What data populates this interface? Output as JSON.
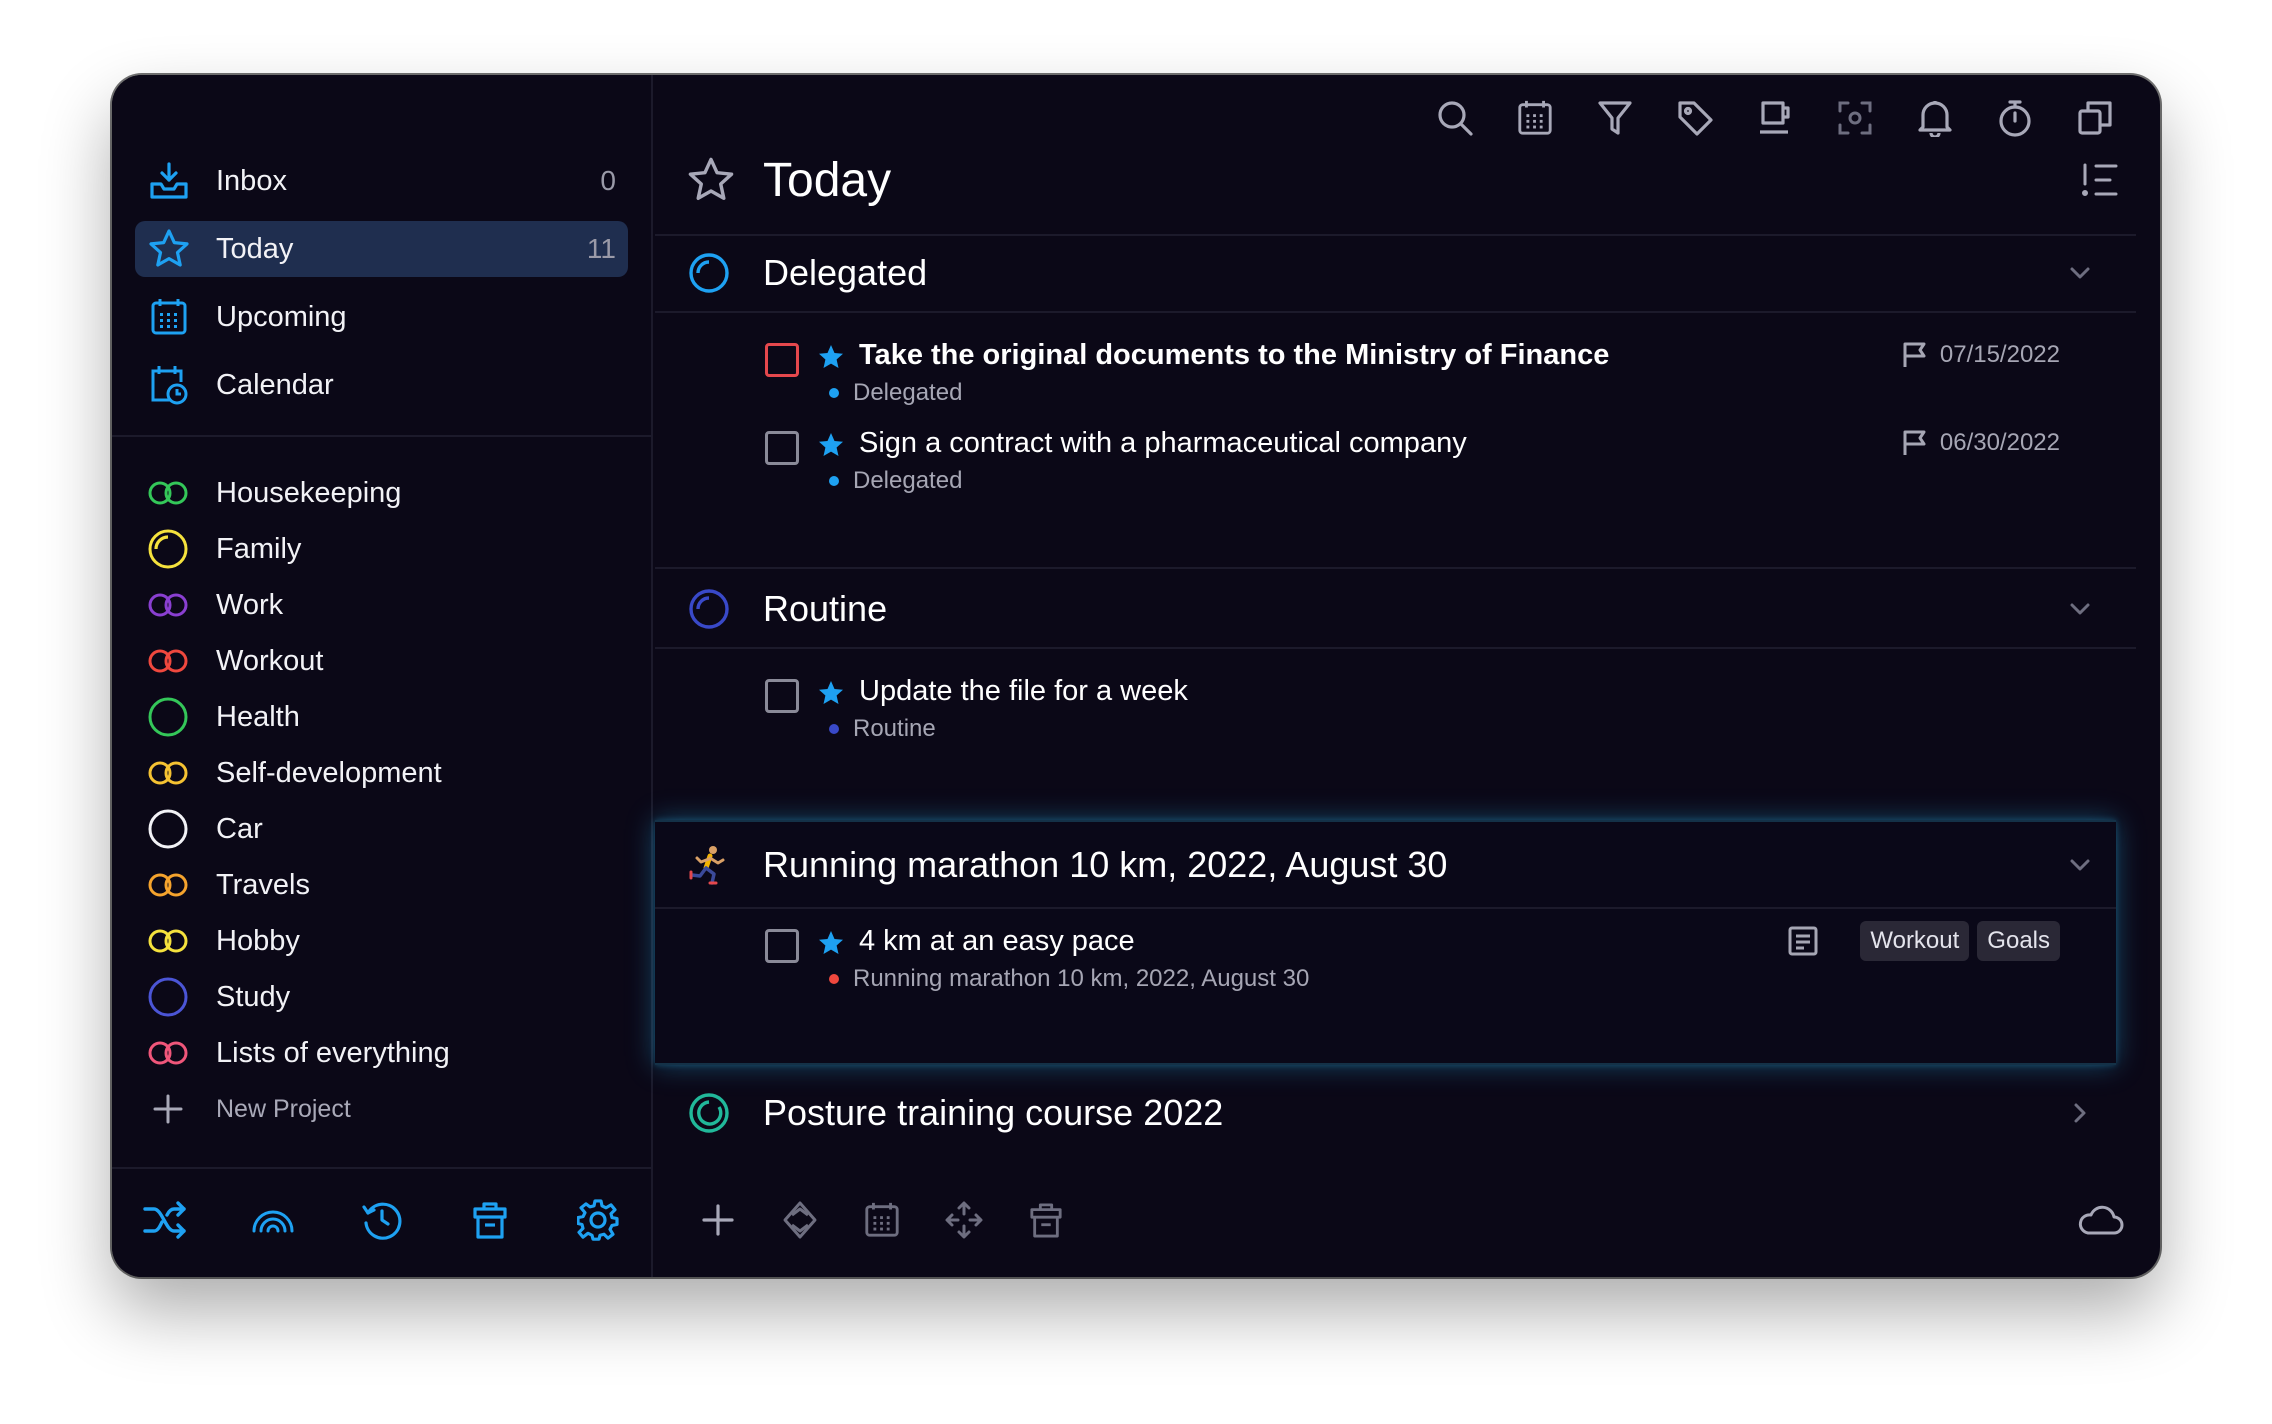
{
  "sidebar": {
    "nav": [
      {
        "label": "Inbox",
        "count": "0",
        "icon": "inbox-tray-icon"
      },
      {
        "label": "Today",
        "count": "11",
        "icon": "star-icon"
      },
      {
        "label": "Upcoming",
        "count": "",
        "icon": "calendar-grid-icon"
      },
      {
        "label": "Calendar",
        "count": "",
        "icon": "calendar-clock-icon"
      }
    ],
    "projects": [
      {
        "label": "Housekeeping",
        "color": "#34c759",
        "icon": "infinity-icon"
      },
      {
        "label": "Family",
        "color": "#f5e23d",
        "icon": "progress-circle-icon"
      },
      {
        "label": "Work",
        "color": "#8a3fd1",
        "icon": "infinity-icon"
      },
      {
        "label": "Workout",
        "color": "#f0483e",
        "icon": "infinity-icon"
      },
      {
        "label": "Health",
        "color": "#34c759",
        "icon": "circle-icon"
      },
      {
        "label": "Self-development",
        "color": "#f5c232",
        "icon": "infinity-icon"
      },
      {
        "label": "Car",
        "color": "#f2f2f6",
        "icon": "circle-icon"
      },
      {
        "label": "Travels",
        "color": "#f5a32d",
        "icon": "infinity-icon"
      },
      {
        "label": "Hobby",
        "color": "#f5e23d",
        "icon": "infinity-icon"
      },
      {
        "label": "Study",
        "color": "#4b55d6",
        "icon": "circle-icon"
      },
      {
        "label": "Lists of everything",
        "color": "#f0567a",
        "icon": "infinity-icon"
      }
    ],
    "new_project_label": "New Project",
    "accent": "#1ea1f2"
  },
  "main": {
    "title": "Today",
    "groups": [
      {
        "title": "Delegated",
        "icon_color": "#1ea1f2",
        "tasks": [
          {
            "title": "Take the original documents to the Ministry of Finance",
            "subtitle": "Delegated",
            "date": "07/15/2022",
            "dot": "#1ea1f2"
          },
          {
            "title": "Sign a contract with a pharmaceutical company",
            "subtitle": "Delegated",
            "date": "06/30/2022",
            "dot": "#1ea1f2"
          }
        ]
      },
      {
        "title": "Routine",
        "icon_color": "#3949c9",
        "tasks": [
          {
            "title": "Update the file for a week",
            "subtitle": "Routine",
            "dot": "#3949c9"
          }
        ]
      },
      {
        "title": "Running marathon 10 km, 2022, August 30",
        "icon": "runner-icon",
        "tasks": [
          {
            "title": "4 km at an easy pace",
            "subtitle": "Running marathon 10 km, 2022, August 30",
            "dot": "#f0483e",
            "tags": [
              "Workout",
              "Goals"
            ]
          }
        ]
      },
      {
        "title": "Posture training course 2022",
        "icon_color": "#21b89a"
      }
    ]
  }
}
